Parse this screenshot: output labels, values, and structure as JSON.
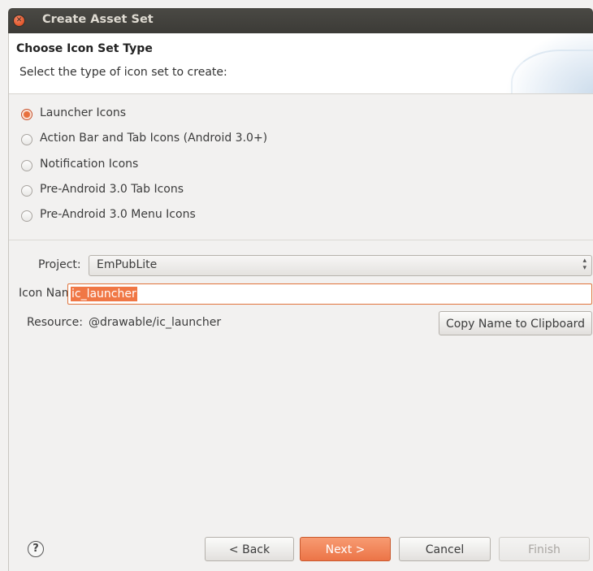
{
  "window": {
    "title": "Create Asset Set"
  },
  "header": {
    "title": "Choose Icon Set Type",
    "description": "Select the type of icon set to create:"
  },
  "icon_types": [
    {
      "label": "Launcher Icons",
      "checked": true
    },
    {
      "label": "Action Bar and Tab Icons (Android 3.0+)",
      "checked": false
    },
    {
      "label": "Notification Icons",
      "checked": false
    },
    {
      "label": "Pre-Android 3.0 Tab Icons",
      "checked": false
    },
    {
      "label": "Pre-Android 3.0 Menu Icons",
      "checked": false
    }
  ],
  "form": {
    "project_label": "Project:",
    "project_value": "EmPubLite",
    "icon_name_label": "Icon Name:",
    "icon_name_value": "ic_launcher",
    "resource_label": "Resource:",
    "resource_value": "@drawable/ic_launcher",
    "copy_button": "Copy Name to Clipboard"
  },
  "footer": {
    "help_icon": "?",
    "back": "< Back",
    "next": "Next >",
    "cancel": "Cancel",
    "finish": "Finish"
  },
  "colors": {
    "accent": "#ec7447",
    "titlebar": "#3c3b37"
  }
}
